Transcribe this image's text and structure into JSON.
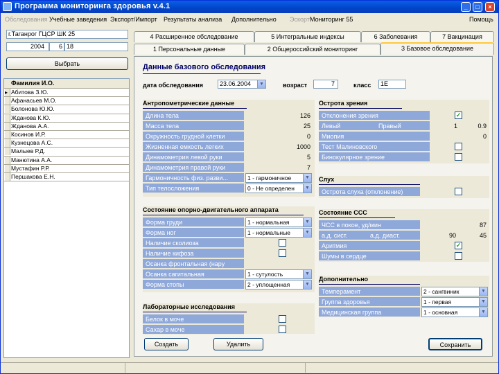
{
  "window": {
    "title": "Программа мониторинга здоровья v.4.1"
  },
  "menu": [
    {
      "label": "Обследования",
      "disabled": true
    },
    {
      "label": "Учебные заведения",
      "disabled": false
    },
    {
      "label": "Экспорт/Импорт",
      "disabled": false
    },
    {
      "label": "Результаты анализа",
      "disabled": false
    },
    {
      "label": "Дополнительно",
      "disabled": false
    },
    {
      "label": "Эскорт",
      "disabled": true
    },
    {
      "label": "Мониторинг 55",
      "disabled": false
    },
    {
      "label": "Помощь",
      "disabled": false
    }
  ],
  "left": {
    "school": "г.Таганрог ГЦСР ШК 25",
    "year": "2004",
    "grade_num": "6",
    "class_code": "18",
    "select_button": "Выбрать",
    "grid_header": "Фамилия И.О.",
    "students": [
      "Абитова З.Ю.",
      "Афанасьев М.О.",
      "Болонова Ю.Ю.",
      "Жданова К.Ю.",
      "Жданова А.А.",
      "Косинов И.Р.",
      "Кузнецова А.С.",
      "Малыев Р.Д.",
      "Манютина А.А.",
      "Мустафин Р.Р.",
      "Першакова Е.Н."
    ]
  },
  "tabs": {
    "row1": [
      "4 Расширенное обследование",
      "5 Интегральные индексы",
      "6 Заболевания",
      "7 Вакцинация"
    ],
    "row2": [
      "1 Персональные данные",
      "2 Общероссийский мониторинг",
      "3 Базовое обследование"
    ]
  },
  "main": {
    "section_title": "Данные базового обследования",
    "date_label": "дата обследования",
    "date_value": "23.06.2004",
    "age_label": "возраст",
    "age_value": "7",
    "class_label": "класс",
    "class_value": "1Е",
    "anthro": {
      "title": "Антропометрические данные",
      "rows": [
        {
          "label": "Длина тела",
          "value": "126"
        },
        {
          "label": "Масса тела",
          "value": "25"
        },
        {
          "label": "Окружность грудной клетки",
          "value": "0"
        },
        {
          "label": "Жизненная емкость легких",
          "value": "1000"
        },
        {
          "label": "Динамометрия левой руки",
          "value": "5"
        },
        {
          "label": "Динамометрия правой руки",
          "value": "7"
        },
        {
          "label": "Гармоничность физ. разви...",
          "value": "1 - гармоничное"
        },
        {
          "label": "Тип телосложения",
          "value": "0 - Не определен"
        }
      ]
    },
    "musculo": {
      "title": "Состояние опорно-двигательного аппарата",
      "rows": [
        {
          "label": "Форма груди",
          "value": "1 - нормальная"
        },
        {
          "label": "Форма ног",
          "value": "1 - нормальные"
        },
        {
          "label": "Наличие сколиоза",
          "value": ""
        },
        {
          "label": "Наличие кифоза",
          "value": ""
        },
        {
          "label": "Осанка фронтальная (нару",
          "value": ""
        },
        {
          "label": "Осанка сагитальная",
          "value": "1 - сутулость"
        },
        {
          "label": "Форма стопы",
          "value": "2 - уплощенная"
        }
      ]
    },
    "lab": {
      "title": "Лабораторные исследования",
      "rows": [
        {
          "label": "Белок в моче",
          "value": ""
        },
        {
          "label": "Сахар в моче",
          "value": ""
        }
      ]
    },
    "vision": {
      "title": "Острота зрения",
      "deviation_label": "Отклонения зрения",
      "left_label": "Левый",
      "right_label": "Правый",
      "left_value": "1",
      "right_value": "0.9",
      "myopia_label": "Миопия",
      "myopia_value": "0",
      "test_label": "Тест Малиновского",
      "binocular_label": "Бинокулярное зрение"
    },
    "hearing": {
      "title": "Слух",
      "row_label": "Острота слуха (отклонение)"
    },
    "cardio": {
      "title": "Состояние ССС",
      "hr_label": "ЧСС в покое, уд/мин",
      "hr_value": "87",
      "bp_sys_label": "а.д. сист.",
      "bp_dia_label": "а.д. диаст.",
      "bp_sys_value": "90",
      "bp_dia_value": "45",
      "arrhythmia_label": "Аритмия",
      "murmur_label": "Шумы в сердце"
    },
    "extra": {
      "title": "Дополнительно",
      "rows": [
        {
          "label": "Темперамент",
          "value": "2 - сангвиник"
        },
        {
          "label": "Группа здоровья",
          "value": "1 - первая"
        },
        {
          "label": "Медицинская группа",
          "value": "1 - основная"
        }
      ]
    },
    "buttons": {
      "create": "Создать",
      "delete": "Удалить",
      "save": "Сохранить"
    }
  },
  "colors": {
    "caption_bg": "#8FA8DA",
    "title_blue": "#0A5FE6"
  }
}
